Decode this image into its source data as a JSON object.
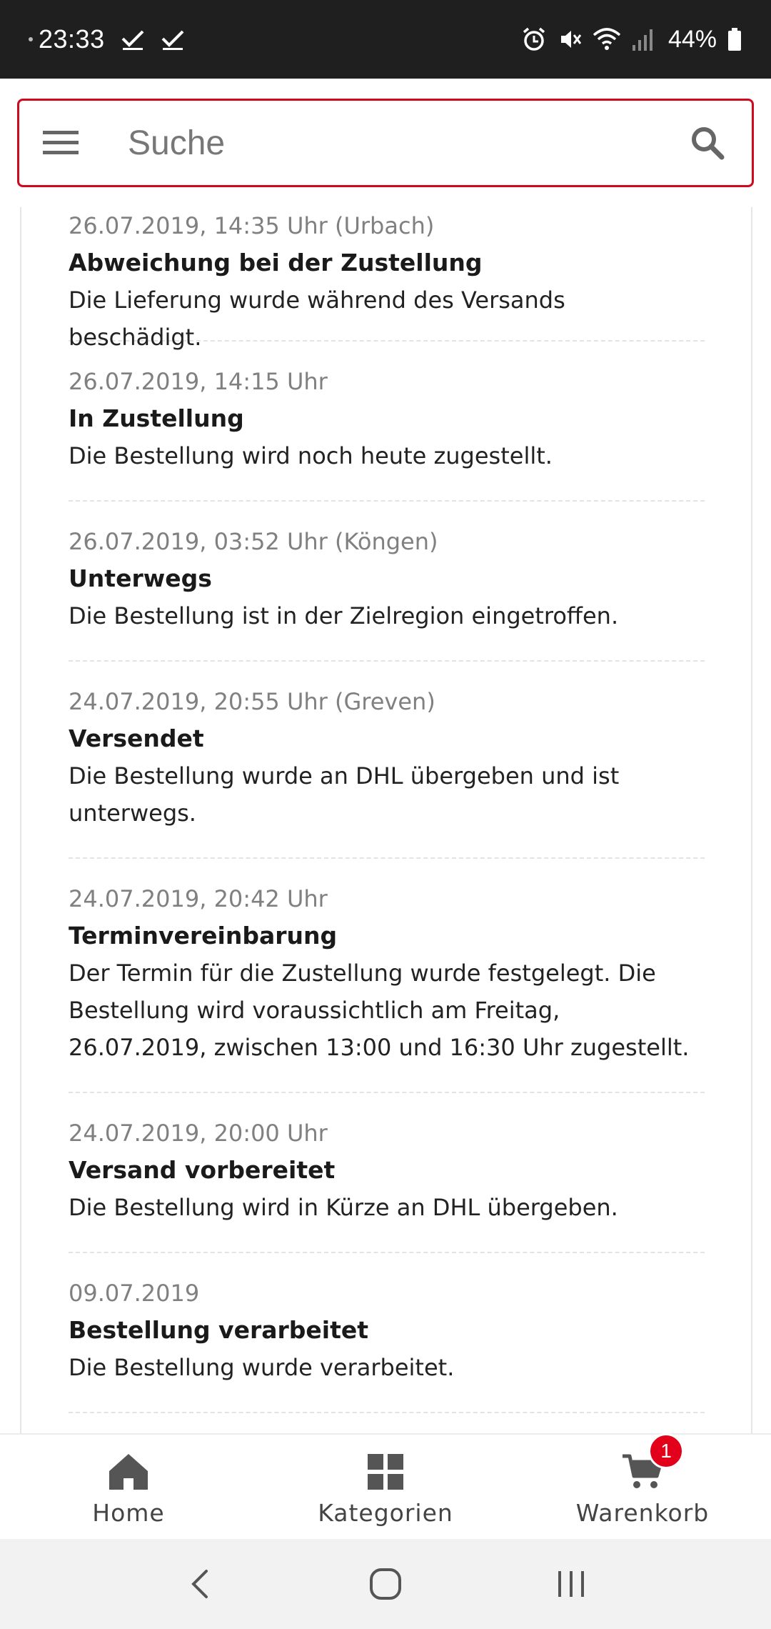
{
  "status_bar": {
    "time": "23:33",
    "battery": "44%"
  },
  "search": {
    "placeholder": "Suche"
  },
  "events": [
    {
      "date": "26.07.2019, 14:35 Uhr (Urbach)",
      "title": "Abweichung bei der Zustellung",
      "description": "Die Lieferung wurde während des Versands beschädigt."
    },
    {
      "date": "26.07.2019, 14:15 Uhr",
      "title": "In Zustellung",
      "description": "Die Bestellung wird noch heute zugestellt."
    },
    {
      "date": "26.07.2019, 03:52 Uhr (Köngen)",
      "title": "Unterwegs",
      "description": "Die Bestellung ist in der Zielregion eingetroffen."
    },
    {
      "date": "24.07.2019, 20:55 Uhr (Greven)",
      "title": "Versendet",
      "description": "Die Bestellung wurde an DHL übergeben und ist unterwegs."
    },
    {
      "date": "24.07.2019, 20:42 Uhr",
      "title": "Terminvereinbarung",
      "description": "Der Termin für die Zustellung wurde festgelegt. Die Bestellung wird voraussichtlich am Freitag, 26.07.2019, zwischen 13:00 und 16:30 Uhr zugestellt."
    },
    {
      "date": "24.07.2019, 20:00 Uhr",
      "title": "Versand vorbereitet",
      "description": "Die Bestellung wird in Kürze an DHL übergeben."
    },
    {
      "date": "09.07.2019",
      "title": "Bestellung verarbeitet",
      "description": "Die Bestellung wurde verarbeitet."
    }
  ],
  "bottom_nav": {
    "home": {
      "label": "Home",
      "icon": "home-icon"
    },
    "categories": {
      "label": "Kategorien",
      "icon": "grid-icon"
    },
    "cart": {
      "label": "Warenkorb",
      "icon": "cart-icon",
      "badge": "1"
    }
  },
  "colors": {
    "accent": "#d0091d",
    "badge": "#e2001a"
  }
}
